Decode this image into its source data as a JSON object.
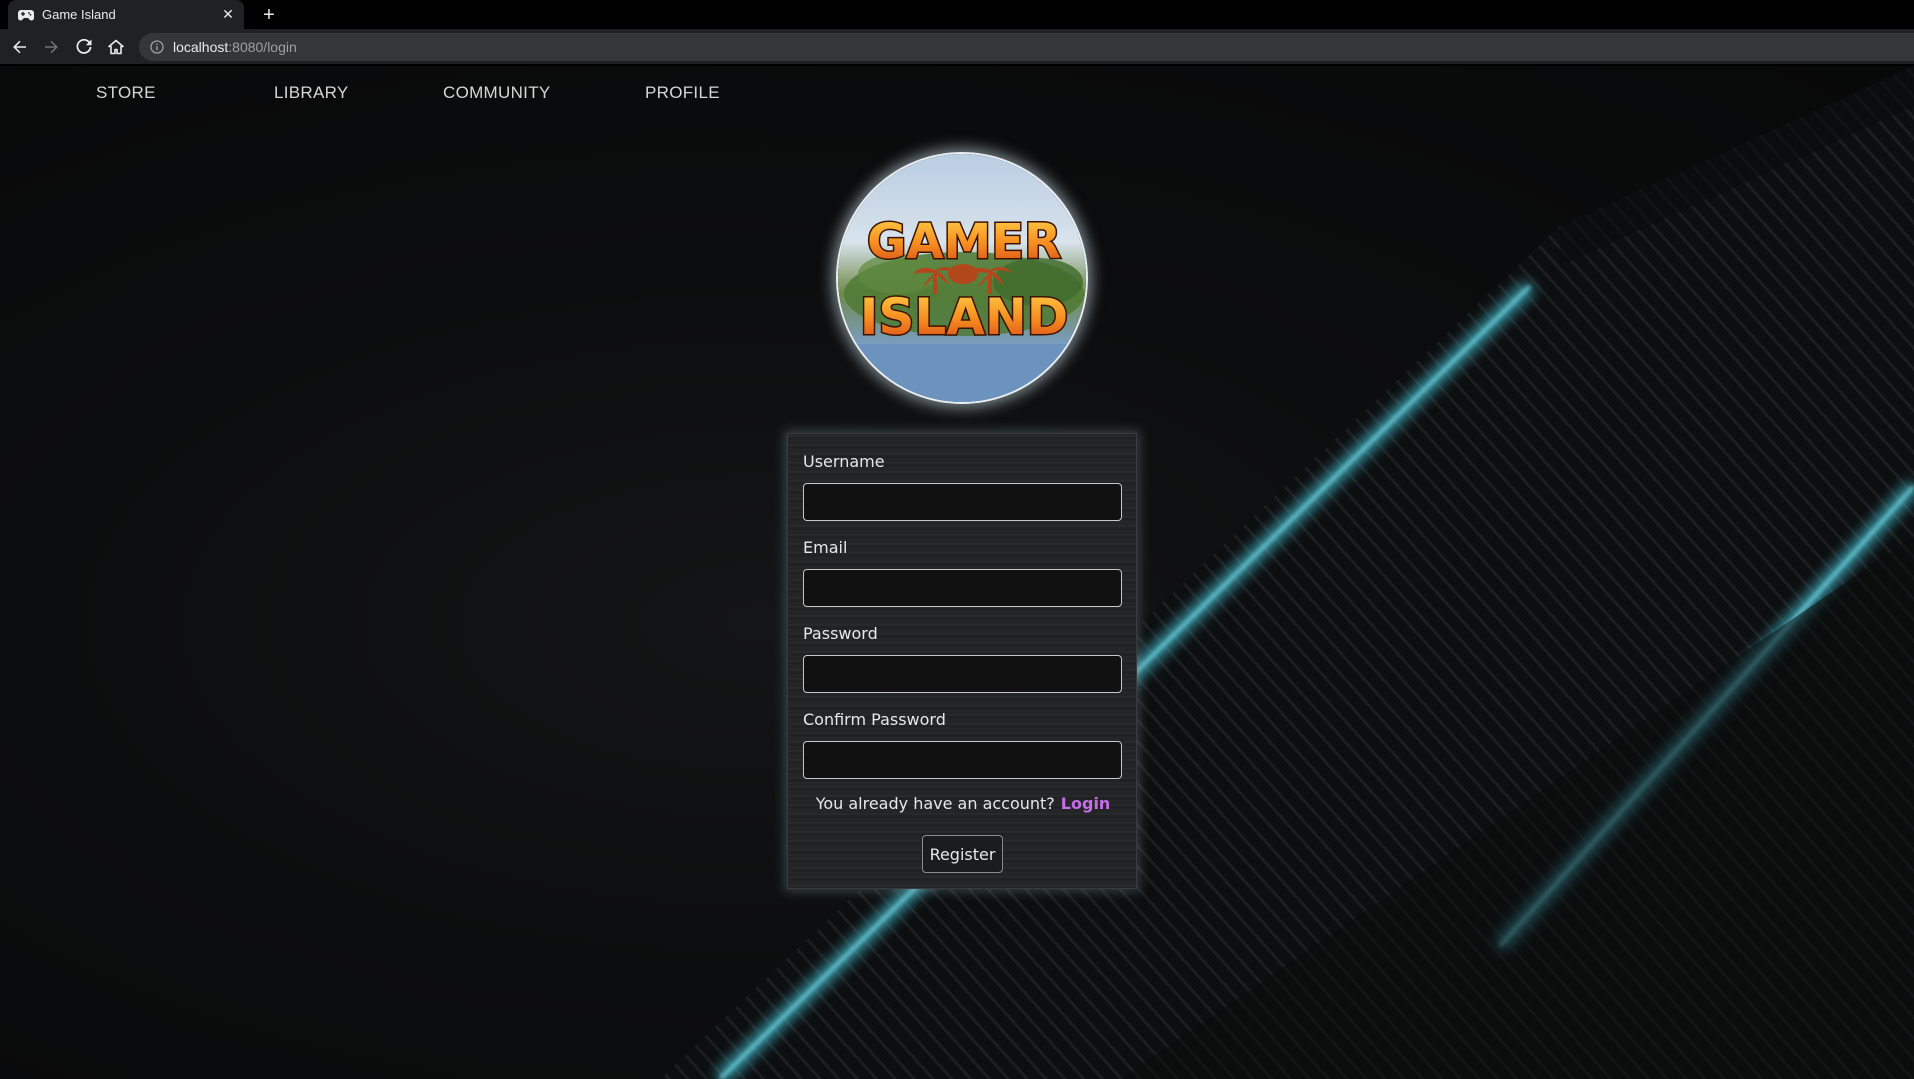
{
  "browser": {
    "tab_title": "Game Island",
    "tab_close": "✕",
    "new_tab": "+",
    "url_host": "localhost",
    "url_rest": ":8080/login"
  },
  "nav": {
    "items": [
      {
        "label": "STORE"
      },
      {
        "label": "LIBRARY"
      },
      {
        "label": "COMMUNITY"
      },
      {
        "label": "PROFILE"
      }
    ]
  },
  "logo": {
    "line1": "GAMER",
    "line2": "ISLAND"
  },
  "form": {
    "username_label": "Username",
    "username_value": "",
    "email_label": "Email",
    "email_value": "",
    "password_label": "Password",
    "password_value": "",
    "confirm_label": "Confirm Password",
    "confirm_value": "",
    "account_text": "You already have an account?",
    "login_link": "Login",
    "register_label": "Register"
  },
  "colors": {
    "accent_link": "#c66de8",
    "glow": "#5ec8d8"
  },
  "icons": {
    "tab_favicon": "gamepad-icon",
    "back": "back-arrow-icon",
    "forward": "forward-arrow-icon",
    "reload": "reload-icon",
    "home": "home-icon",
    "site_info": "info-icon"
  }
}
